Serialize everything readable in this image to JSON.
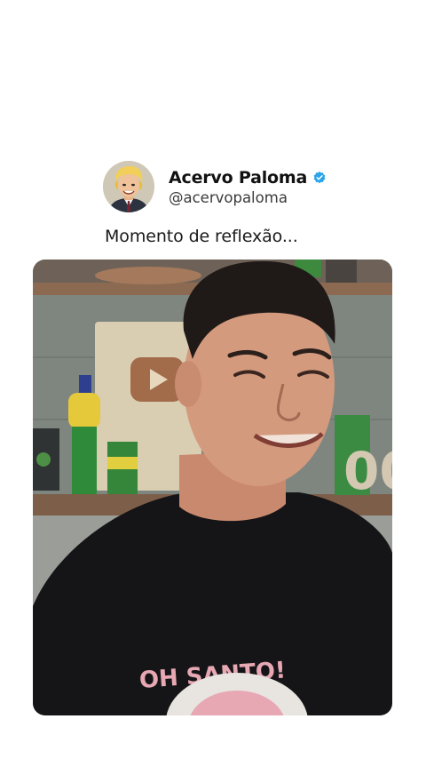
{
  "author": {
    "display_name": "Acervo Paloma",
    "handle": "@acervopaloma",
    "verified": true,
    "verified_color": "#1da1f2",
    "avatar_icon": "caricature-avatar"
  },
  "tweet": {
    "text": "Momento de reflexão..."
  },
  "media": {
    "type": "video-frame",
    "shirt_text": "OH SANTO!"
  }
}
